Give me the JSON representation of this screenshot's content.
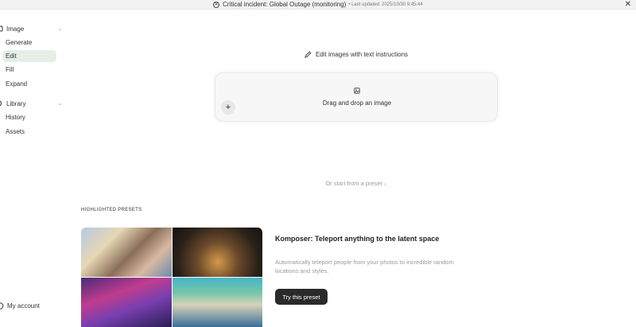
{
  "banner": {
    "incident_text": "Critical incident: Global Outage (monitoring)",
    "updated_text": "• Last updated: 2025/10/30 9:45:44",
    "close_symbol": "✕",
    "status_icon": "x-circle-icon"
  },
  "sidebar": {
    "image_group": {
      "label": "Image",
      "chevron": "⌄"
    },
    "image_items": [
      {
        "label": "Generate",
        "active": false
      },
      {
        "label": "Edit",
        "active": true
      },
      {
        "label": "Fill",
        "active": false
      },
      {
        "label": "Expand",
        "active": false
      }
    ],
    "library_group": {
      "label": "Library",
      "chevron": "⌄"
    },
    "library_items": [
      {
        "label": "History"
      },
      {
        "label": "Assets"
      }
    ],
    "account_label": "My account"
  },
  "main": {
    "edit_title": "Edit images with text instructions",
    "dropzone_text": "Drag and drop an image",
    "add_symbol": "+",
    "preset_hint": "Or start from a preset ↓",
    "section_label": "HIGHLIGHTED PRESETS",
    "preset": {
      "title": "Komposer: Teleport anything to the latent space",
      "description": "Automatically teleport people from your photos to incredible random locations and styles.",
      "button_label": "Try this preset"
    }
  },
  "colors": {
    "active_nav_bg": "#e5efe8",
    "button_bg": "#2a2a2a",
    "hint_text": "#9a9a9a"
  }
}
